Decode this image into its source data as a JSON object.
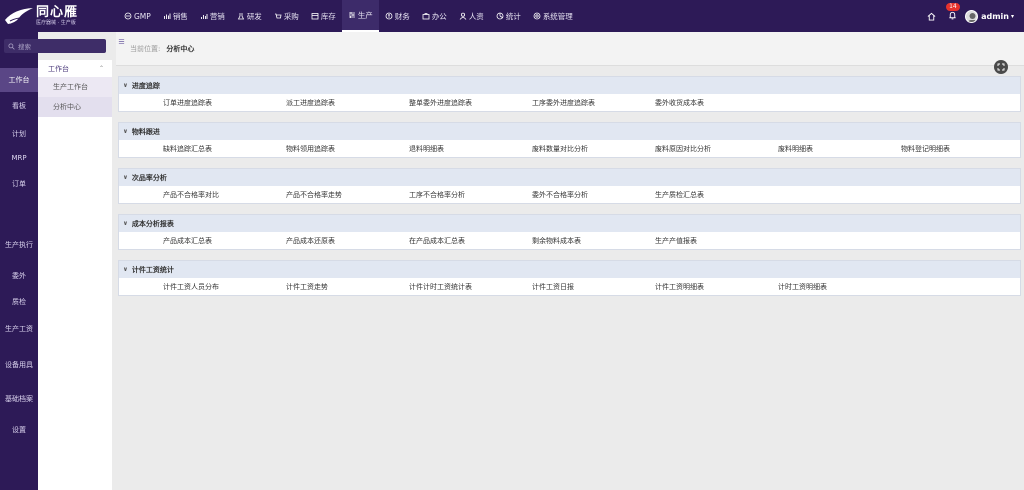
{
  "logo": {
    "title": "同心雁",
    "subtitle": "医疗器械 · 生产版"
  },
  "nav": [
    {
      "label": "GMP",
      "icon": "gmp-icon"
    },
    {
      "label": "销售",
      "icon": "sales-chart-icon"
    },
    {
      "label": "营销",
      "icon": "marketing-chart-icon"
    },
    {
      "label": "研发",
      "icon": "rnd-icon"
    },
    {
      "label": "采购",
      "icon": "purchase-icon"
    },
    {
      "label": "库存",
      "icon": "inventory-icon"
    },
    {
      "label": "生产",
      "icon": "production-icon",
      "active": true
    },
    {
      "label": "财务",
      "icon": "finance-icon"
    },
    {
      "label": "办公",
      "icon": "office-icon"
    },
    {
      "label": "人资",
      "icon": "hr-icon"
    },
    {
      "label": "统计",
      "icon": "stats-icon"
    },
    {
      "label": "系统管理",
      "icon": "settings-icon"
    }
  ],
  "topright": {
    "badge": "14",
    "user": "admin"
  },
  "search": {
    "placeholder": "搜索"
  },
  "sidebar": [
    {
      "label": "工作台",
      "active": true
    },
    {
      "label": "看板"
    },
    {
      "label": "计划"
    },
    {
      "label": "MRP"
    },
    {
      "label": "订单"
    },
    {
      "label": "生产执行"
    },
    {
      "label": "委外"
    },
    {
      "label": "质检"
    },
    {
      "label": "生产工资"
    },
    {
      "label": "设备用具"
    },
    {
      "label": "基础档案"
    },
    {
      "label": "设置"
    }
  ],
  "subside": {
    "group": "工作台",
    "items": [
      {
        "label": "生产工作台"
      },
      {
        "label": "分析中心",
        "active": true
      }
    ]
  },
  "breadcrumb": {
    "prefix": "当前位置:",
    "current": "分析中心"
  },
  "sections": [
    {
      "title": "进度追踪",
      "links": [
        "订单进度追踪表",
        "派工进度追踪表",
        "整单委外进度追踪表",
        "工序委外进度追踪表",
        "委外收货成本表"
      ]
    },
    {
      "title": "物料跟进",
      "links": [
        "缺料追踪汇总表",
        "物料领用追踪表",
        "退料明细表",
        "废料数量对比分析",
        "废料原因对比分析",
        "废料明细表",
        "物料登记明细表"
      ]
    },
    {
      "title": "次品率分析",
      "links": [
        "产品不合格率对比",
        "产品不合格率走势",
        "工序不合格率分析",
        "委外不合格率分析",
        "生产质检汇总表"
      ]
    },
    {
      "title": "成本分析报表",
      "links": [
        "产品成本汇总表",
        "产品成本还原表",
        "在产品成本汇总表",
        "剩余物料成本表",
        "生产产值报表"
      ]
    },
    {
      "title": "计件工资统计",
      "links": [
        "计件工资人员分布",
        "计件工资走势",
        "计件计时工资统计表",
        "计件工资日报",
        "计件工资明细表",
        "计时工资明细表"
      ]
    }
  ],
  "colors": {
    "topbar": "#2d1a57",
    "sectionHead": "#e1e7f2",
    "badge": "#e8322d"
  }
}
